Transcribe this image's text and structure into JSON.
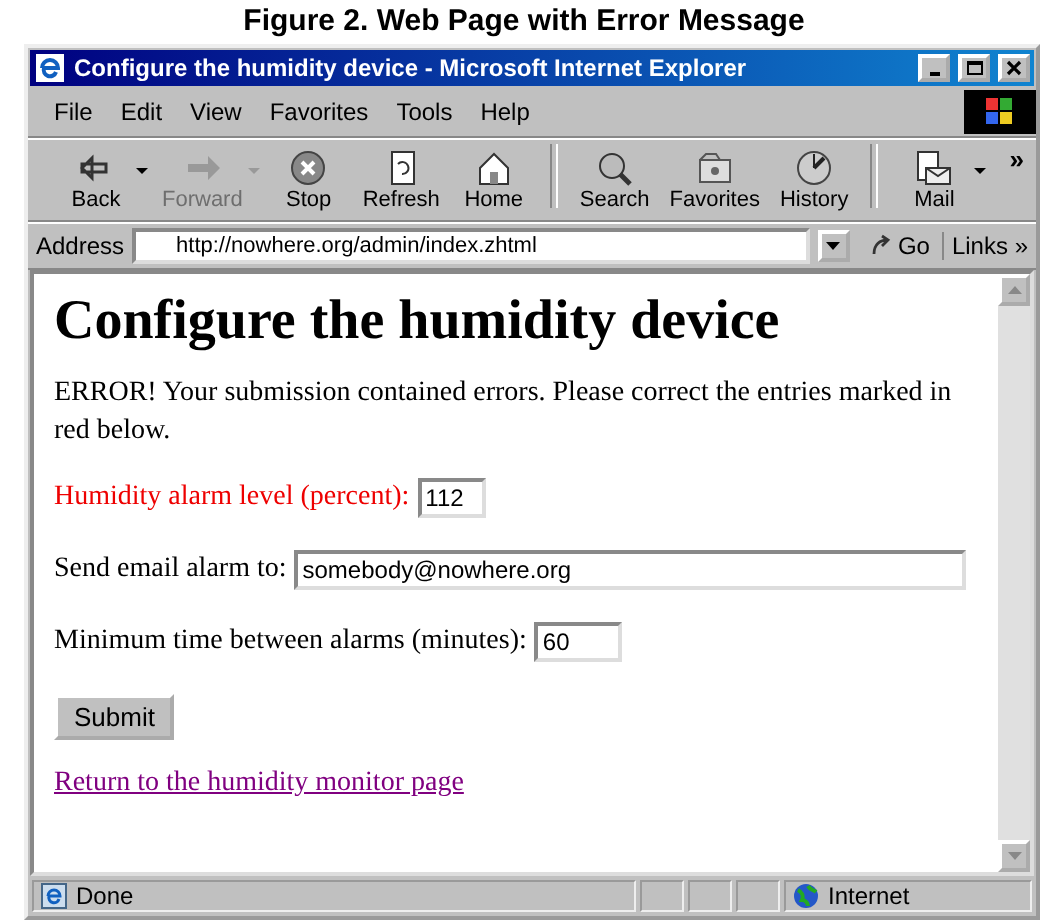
{
  "caption": "Figure 2.  Web Page with Error Message",
  "window": {
    "title": "Configure the humidity device - Microsoft Internet Explorer"
  },
  "menu": [
    "File",
    "Edit",
    "View",
    "Favorites",
    "Tools",
    "Help"
  ],
  "toolbar": [
    {
      "kind": "back",
      "label": "Back",
      "disabled": false,
      "dropdown": true
    },
    {
      "kind": "forward",
      "label": "Forward",
      "disabled": true,
      "dropdown": true
    },
    {
      "kind": "stop",
      "label": "Stop",
      "disabled": false,
      "dropdown": false
    },
    {
      "kind": "refresh",
      "label": "Refresh",
      "disabled": false,
      "dropdown": false
    },
    {
      "kind": "home",
      "label": "Home",
      "disabled": false,
      "dropdown": false
    },
    {
      "kind": "separator"
    },
    {
      "kind": "search",
      "label": "Search",
      "disabled": false,
      "dropdown": false
    },
    {
      "kind": "favorites",
      "label": "Favorites",
      "disabled": false,
      "dropdown": false
    },
    {
      "kind": "history",
      "label": "History",
      "disabled": false,
      "dropdown": false
    },
    {
      "kind": "separator"
    },
    {
      "kind": "mail",
      "label": "Mail",
      "disabled": false,
      "dropdown": true
    }
  ],
  "toolbar_more": "»",
  "address": {
    "label": "Address",
    "value": "http://nowhere.org/admin/index.zhtml",
    "go": "Go",
    "links": "Links",
    "links_more": "»"
  },
  "page": {
    "heading": "Configure the humidity device",
    "message": "ERROR! Your submission contained errors. Please correct the entries marked in red below.",
    "fields": [
      {
        "label": "Humidity alarm level (percent):",
        "value": "112",
        "error": true
      },
      {
        "label": "Send email alarm to:",
        "value": "somebody@nowhere.org",
        "error": false
      },
      {
        "label": "Minimum time between alarms (minutes):",
        "value": "60",
        "error": false
      }
    ],
    "submit": "Submit",
    "link": {
      "text": "Return to the humidity monitor page",
      "visited": true
    }
  },
  "status": {
    "text": "Done",
    "zone": "Internet"
  }
}
